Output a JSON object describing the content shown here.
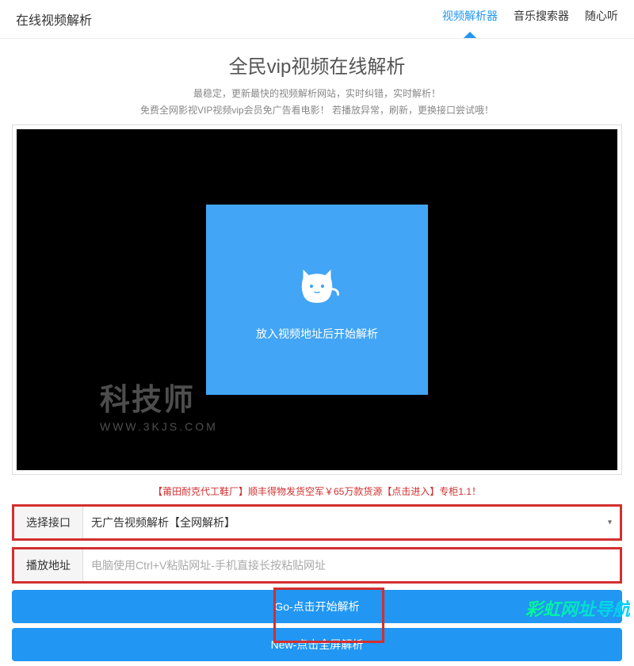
{
  "header": {
    "title": "在线视频解析",
    "nav": [
      {
        "label": "视频解析器",
        "active": true
      },
      {
        "label": "音乐搜索器",
        "active": false
      },
      {
        "label": "随心听",
        "active": false
      }
    ]
  },
  "main": {
    "title": "全民vip视频在线解析",
    "subtitle1": "最稳定，更新最快的视频解析网站，实时纠错，实时解析！",
    "subtitle2": "免费全网影视VIP视频vip会员免广告看电影！ 若播放异常，刷新，更换接口尝试哦！"
  },
  "video": {
    "placeholder_text": "放入视频地址后开始解析",
    "watermark_main": "科技师",
    "watermark_sub": "WWW.3KJS.COM"
  },
  "promo": "【莆田耐克代工鞋厂】顺丰得物发货空军￥65万款货源【点击进入】专柜1.1！",
  "form": {
    "interface_label": "选择接口",
    "interface_selected": "无广告视频解析【全网解析】",
    "address_label": "播放地址",
    "address_placeholder": "电脑使用Ctrl+V粘贴网址-手机直接长按粘贴网址"
  },
  "buttons": {
    "go": "Go-点击开始解析",
    "new": "New-点击全屏解析"
  },
  "footer_brand": "彩虹网址导航"
}
